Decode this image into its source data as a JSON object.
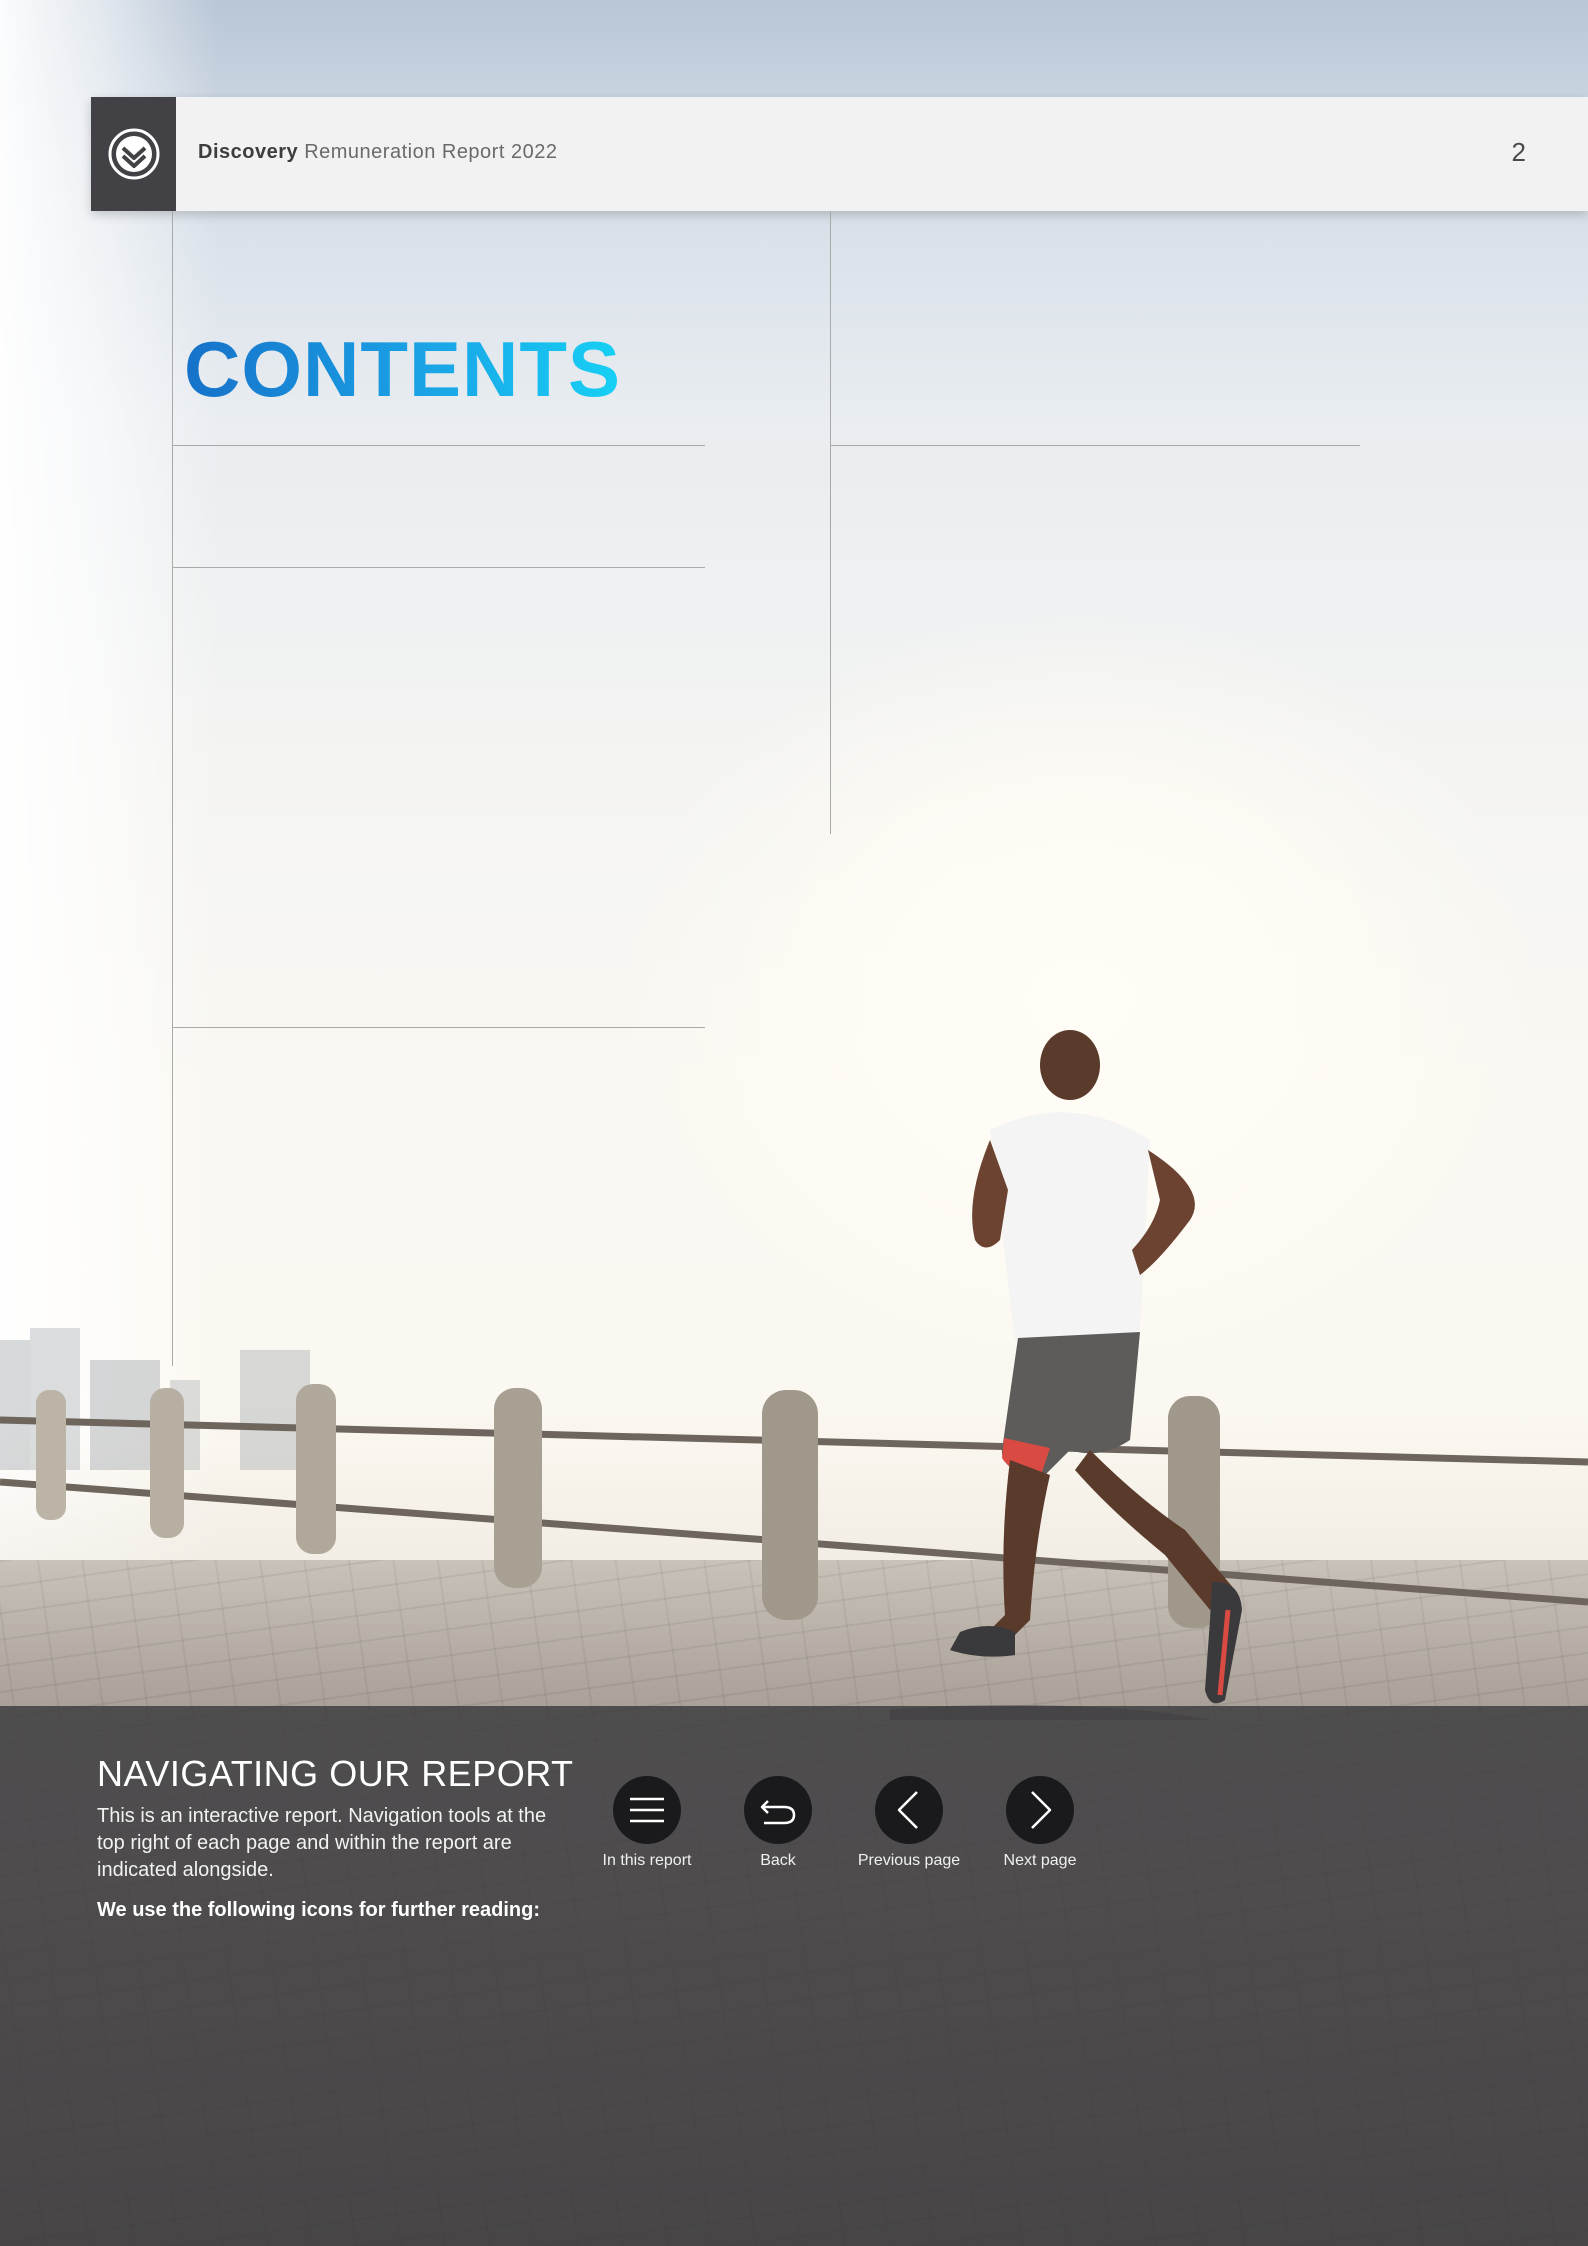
{
  "header": {
    "brand": "Discovery",
    "report_title": "Remuneration Report 2022",
    "page_number": "2",
    "logo_icon": "discovery-logo-icon"
  },
  "contents": {
    "title": "CONTENTS"
  },
  "navigation": {
    "heading": "NAVIGATING OUR REPORT",
    "description": "This is an interactive report. Navigation tools at the top right of each page and within the report are indicated alongside.",
    "icons_note": "We use the following icons for further reading:",
    "buttons": [
      {
        "label": "In this report",
        "icon": "menu-icon"
      },
      {
        "label": "Back",
        "icon": "back-arrow-icon"
      },
      {
        "label": "Previous page",
        "icon": "chevron-left-icon"
      },
      {
        "label": "Next page",
        "icon": "chevron-right-icon"
      }
    ]
  },
  "colors": {
    "title_gradient_start": "#1671c9",
    "title_gradient_end": "#16d0f4",
    "header_bg": "#f2f2f2",
    "logo_bg": "#414146",
    "nav_panel_bg": "#38383c",
    "nav_button_bg": "#1a1a1c"
  }
}
